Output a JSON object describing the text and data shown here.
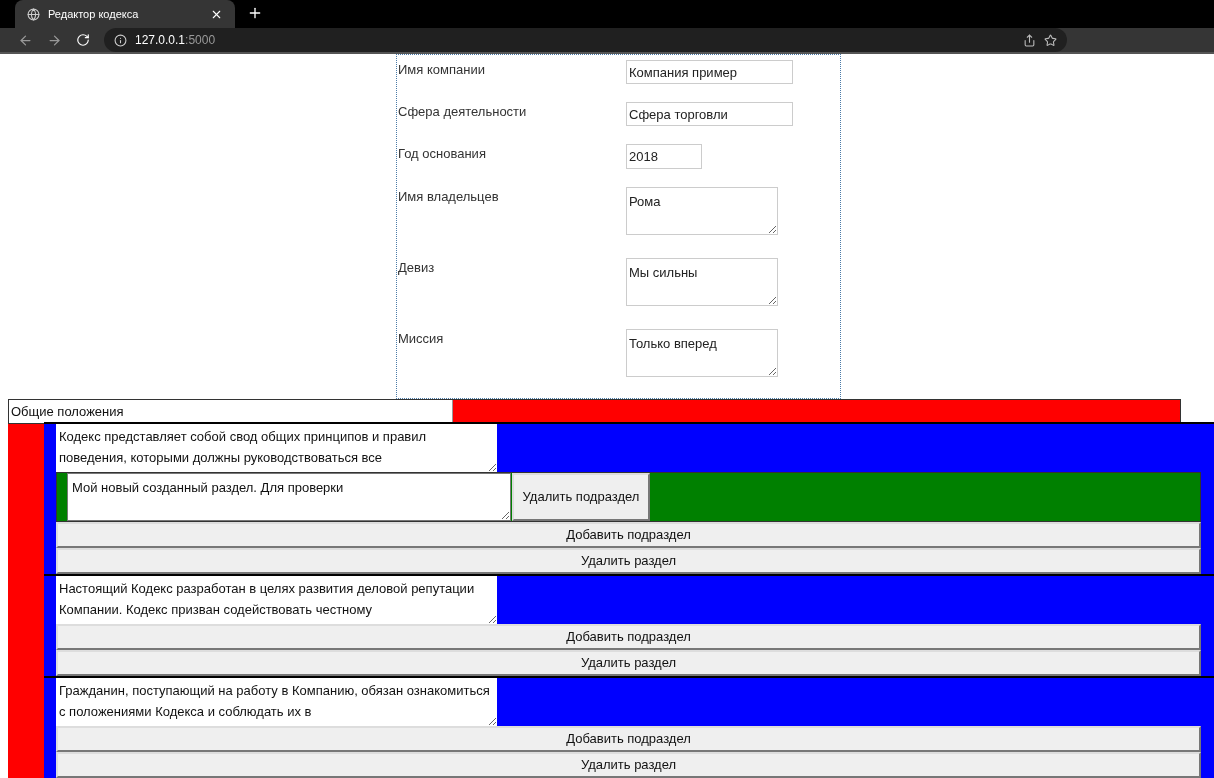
{
  "browser": {
    "tab_title": "Редактор кодекса",
    "url_host": "127.0.0.1",
    "url_port": ":5000"
  },
  "form": {
    "fields": [
      {
        "label": "Имя компании",
        "value": "Компания пример",
        "kind": "input"
      },
      {
        "label": "Сфера деятельности",
        "value": "Сфера торговли",
        "kind": "input"
      },
      {
        "label": "Год основания",
        "value": "2018",
        "kind": "short"
      },
      {
        "label": "Имя владельцев",
        "value": "Рома",
        "kind": "textarea"
      },
      {
        "label": "Девиз",
        "value": "Мы сильны",
        "kind": "textarea"
      },
      {
        "label": "Миссия",
        "value": "Только вперед",
        "kind": "textarea"
      }
    ]
  },
  "chapter": {
    "title": "Общие положения",
    "sections": [
      {
        "text": "Кодекс представляет собой свод общих принципов и правил поведения, которыми должны руководствоваться все",
        "subsections": [
          {
            "text": "Мой новый созданный раздел. Для проверки",
            "delete_label": "Удалить подраздел"
          }
        ],
        "add_label": "Добавить подраздел",
        "delete_label": "Удалить раздел"
      },
      {
        "text": "Настоящий Кодекс разработан в целях развития деловой репутации Компании. Кодекс призван содействовать честному",
        "add_label": "Добавить подраздел",
        "delete_label": "Удалить раздел"
      },
      {
        "text": "Гражданин, поступающий на работу в Компанию, обязан ознакомиться с положениями Кодекса и соблюдать их в",
        "add_label": "Добавить подраздел",
        "delete_label": "Удалить раздел"
      }
    ]
  }
}
